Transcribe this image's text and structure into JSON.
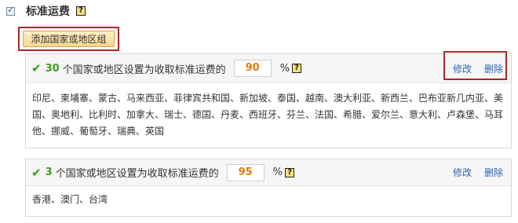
{
  "section": {
    "title": "标准运费",
    "help_glyph": "?",
    "checkbox_checked": true,
    "add_button_label": "添加国家或地区组"
  },
  "groups": [
    {
      "count": "30",
      "description": " 个国家或地区设置为收取标准运费的",
      "percent_value": "90",
      "percent_sign": "%",
      "edit_label": "修改",
      "delete_label": "删除",
      "countries": "印尼、柬埔寨、蒙古、马来西亚、菲律宾共和国、新加坡、泰国、越南、澳大利亚、新西兰、巴布亚新几内亚、美国、奥地利、比利时、加拿大、瑞士、德国、丹麦、西班牙、芬兰、法国、希腊、爱尔兰、意大利、卢森堡、马耳他、挪威、葡萄牙、瑞典、英国"
    },
    {
      "count": "3",
      "description": " 个国家或地区设置为收取标准运费的",
      "percent_value": "95",
      "percent_sign": "%",
      "edit_label": "修改",
      "delete_label": "删除",
      "countries": "香港、澳门、台湾"
    }
  ],
  "colors": {
    "accent_green": "#3a9d23",
    "percent_orange": "#e07c12",
    "link_blue": "#2f63b0",
    "highlight_frame": "#a52a2a"
  }
}
